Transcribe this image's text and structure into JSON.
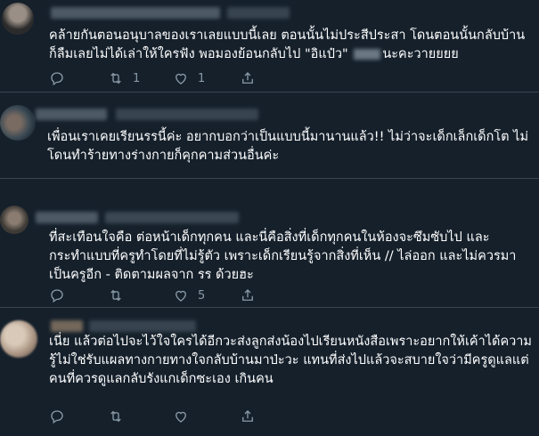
{
  "tweets": [
    {
      "text": "คล้ายกันตอนอนุบาลของเราเลยแบบนี้เลย  ตอนนั้นไม่ประสีประสา โดนตอนนั้นกลับบ้าน\nก็ลืมเลยไม่ได้เล่าให้ใครฟัง พอมองย้อนกลับไป \"อิแป๋ว\"",
      "text_tail": "นะคะวายยยย",
      "reply_count": "",
      "retweet_count": "1",
      "like_count": "1"
    },
    {
      "text": "เพื่อนเราเคยเรียนรรนี้ค่ะ อยากบอกว่าเป็นแบบนี้มานานแล้ว!! ไม่ว่าจะเด็กเล็กเด็กโต ไม่\nโดนทำร้ายทางร่างกายก็คุกคามส่วนอื่นค่ะ",
      "reply_count": "",
      "retweet_count": "",
      "like_count": ""
    },
    {
      "text": "ที่สะเทือนใจคือ ต่อหน้าเด็กทุกคน และนี่คือสิ่งที่เด็กทุกคนในห้องจะซึมซับไป และ\nกระทำแบบที่ครูทำโดยที่ไม่รู้ตัว เพราะเด็กเรียนรู้จากสิ่งที่เห็น // ไล่ออก และไม่ควรมา\nเป็นครูอีก - ติดตามผลจาก รร ด้วยฮะ",
      "reply_count": "",
      "retweet_count": "",
      "like_count": "5"
    },
    {
      "text": "เนี่ย แล้วต่อไปจะไว้ใจใครได้อีกวะส่งลูกส่งน้องไปเรียนหนังสือเพราะอยากให้เค้าได้ความ\nรู้ไม่ใช่รับแผลทางกายทางใจกลับบ้านมาป่ะวะ แทนที่ส่งไปแล้วจะสบายใจว่ามีครูดูแลแต่\nคนที่ควรดูแลกลับรังแกเด็กซะเอง เกินคน",
      "reply_count": "",
      "retweet_count": "",
      "like_count": ""
    }
  ],
  "colors": {
    "background": "#15202b",
    "divider": "#38444d",
    "text": "#ffffff",
    "icon": "#8899a6"
  },
  "icons": [
    "reply-icon",
    "retweet-icon",
    "like-icon",
    "share-icon"
  ]
}
